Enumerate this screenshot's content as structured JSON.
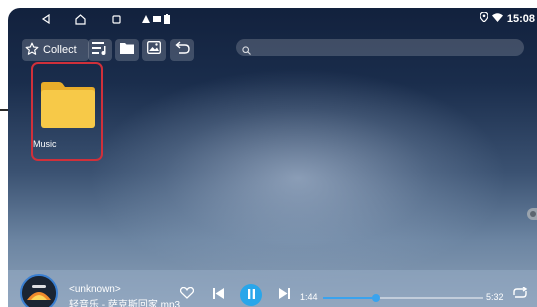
{
  "status_bar": {
    "time": "15:08",
    "icons": [
      "back-icon",
      "home-icon",
      "recents-icon",
      "warning-icon",
      "storage-icon",
      "battery-icon",
      "location-icon",
      "wifi-icon"
    ]
  },
  "toolbar": {
    "collect_label": "Collect",
    "buttons": [
      "music-list-icon",
      "folder-icon",
      "image-icon",
      "return-icon"
    ],
    "search_placeholder": ""
  },
  "files": [
    {
      "name": "Music",
      "type": "folder",
      "selected": true
    }
  ],
  "player": {
    "title": "<unknown>",
    "file": "轻音乐 - 萨克斯回家.mp3",
    "current_time": "1:44",
    "total_time": "5:32",
    "progress_fraction": 0.33,
    "state": "playing"
  },
  "colors": {
    "accent": "#29a6ea",
    "selection_border": "#d0303a",
    "folder_yellow": "#f7c948"
  }
}
